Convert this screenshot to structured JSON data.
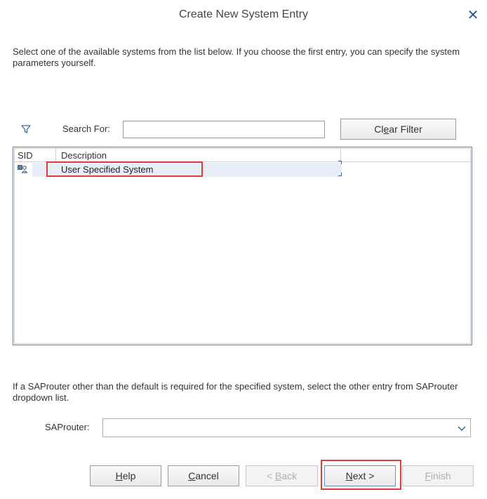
{
  "dialog": {
    "title": "Create New System Entry",
    "close_glyph": "✕"
  },
  "intro_text": "Select one of the available systems from the list below. If you choose the first entry, you can specify the system parameters yourself.",
  "filter": {
    "search_label": "Search For:",
    "search_value": "",
    "clear_button_label": "Clear Filter"
  },
  "list": {
    "columns": [
      "SID",
      "Description"
    ],
    "rows": [
      {
        "sid": "",
        "description": "User Specified System",
        "icon": "system-user-icon",
        "selected": true
      }
    ]
  },
  "saprouter": {
    "info_text": "If a SAProuter other than the default is required for the specified system, select the other entry from SAProuter dropdown list.",
    "label": "SAProuter:",
    "selected_value": ""
  },
  "buttons": {
    "help": "Help",
    "cancel": "Cancel",
    "back": "< Back",
    "next": "Next >",
    "finish": "Finish"
  },
  "colors": {
    "highlight": "#d9403a",
    "selection": "#e7eef6",
    "accent": "#2a5a8a"
  }
}
